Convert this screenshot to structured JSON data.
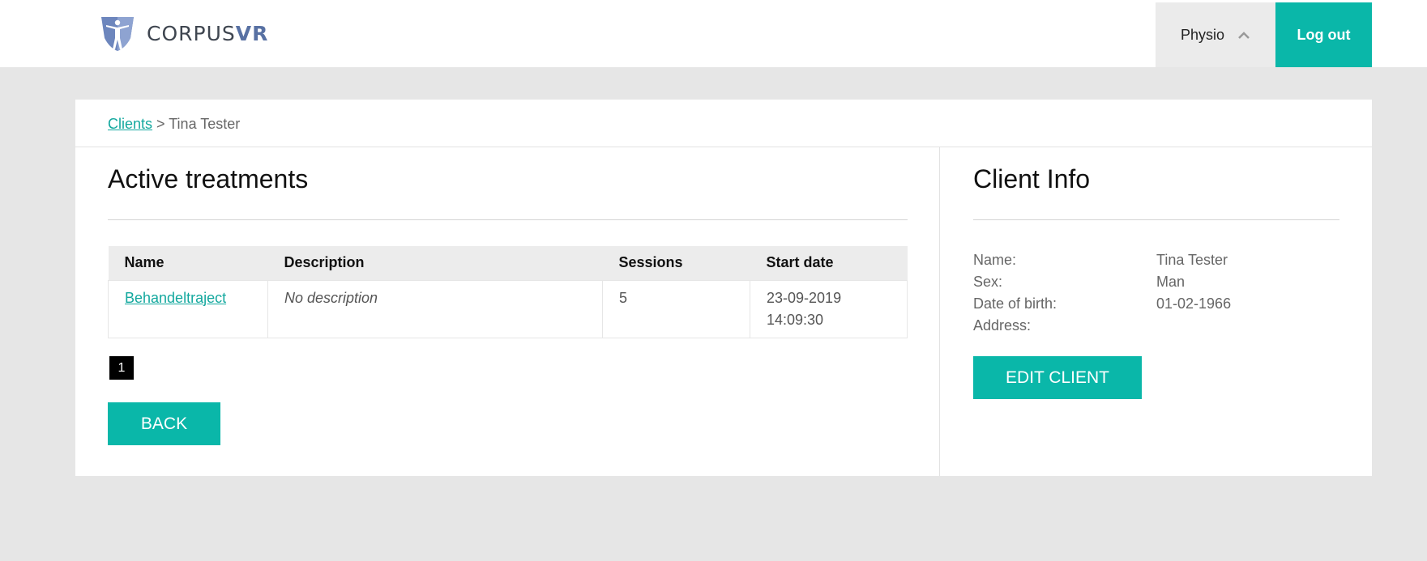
{
  "header": {
    "logo_text_a": "CORPUS",
    "logo_text_b": "VR",
    "user_label": "Physio",
    "logout_label": "Log out",
    "accent_color": "#0ab7a9"
  },
  "breadcrumb": {
    "root_label": "Clients",
    "separator": " > ",
    "current": "Tina Tester"
  },
  "treatments": {
    "title": "Active treatments",
    "columns": [
      "Name",
      "Description",
      "Sessions",
      "Start date"
    ],
    "rows": [
      {
        "name": "Behandeltraject",
        "description": "No description",
        "sessions": "5",
        "start_date": "23-09-2019",
        "start_time": "14:09:30"
      }
    ],
    "current_page": "1",
    "back_label": "BACK"
  },
  "client_info": {
    "title": "Client Info",
    "fields": [
      {
        "label": "Name:",
        "value": "Tina Tester"
      },
      {
        "label": "Sex:",
        "value": "Man"
      },
      {
        "label": "Date of birth:",
        "value": "01-02-1966"
      },
      {
        "label": "Address:",
        "value": ""
      }
    ],
    "edit_label": "EDIT CLIENT"
  }
}
